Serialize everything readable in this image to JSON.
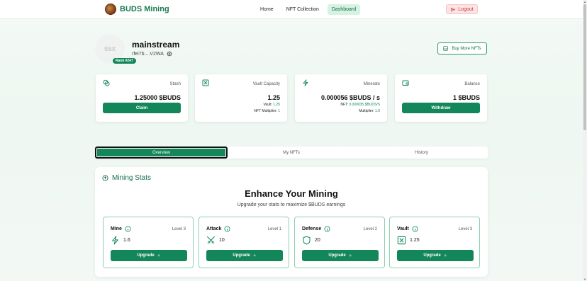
{
  "header": {
    "brand": "BUDS Mining",
    "nav": [
      "Home",
      "NFT Collection",
      "Dashboard"
    ],
    "active_nav": "Dashboard",
    "logout": "Logout"
  },
  "profile": {
    "avatar_initials": "SSX",
    "username": "mainstream",
    "wallet": "rfei7b....V2WA",
    "rank": "Rank #247",
    "buy_button": "Buy More NFTs"
  },
  "stats": {
    "stash": {
      "label": "Stash",
      "value": "1.25000 $BUDS",
      "button": "Claim"
    },
    "vault": {
      "label": "Vault Capacity",
      "value": "1.25",
      "sub1_label": "Vault:",
      "sub1_value": "1.25",
      "sub2_label": "NFT Multiplier:",
      "sub2_value": "1"
    },
    "minerate": {
      "label": "Minerate",
      "value": "0.000056 $BUDS / s",
      "sub1_label": "NFT:",
      "sub1_value": "0.000035 $BUDS/S",
      "sub2_label": "Multiplier:",
      "sub2_value": "1.6"
    },
    "balance": {
      "label": "Balance",
      "value": "1 $BUDS",
      "button": "Withdraw"
    }
  },
  "tabs": [
    "Overview",
    "My NFTs",
    "History"
  ],
  "active_tab": "Overview",
  "mining": {
    "section_title": "Mining Stats",
    "heading": "Enhance Your Mining",
    "subheading": "Upgrade your stats to maximize $BUDS earnings",
    "upgrades": [
      {
        "name": "Mine",
        "level": "Level 3",
        "value": "1.6",
        "button": "Upgrade",
        "icon": "lightning-icon"
      },
      {
        "name": "Attack",
        "level": "Level 1",
        "value": "10",
        "button": "Upgrade",
        "icon": "swords-icon"
      },
      {
        "name": "Defense",
        "level": "Level 2",
        "value": "20",
        "button": "Upgrade",
        "icon": "shield-icon"
      },
      {
        "name": "Vault",
        "level": "Level 3",
        "value": "1.25",
        "button": "Upgrade",
        "icon": "vault-icon"
      }
    ]
  },
  "colors": {
    "accent": "#13865a",
    "logout_bg": "#fde3e3",
    "logout_text": "#c23b3b"
  }
}
